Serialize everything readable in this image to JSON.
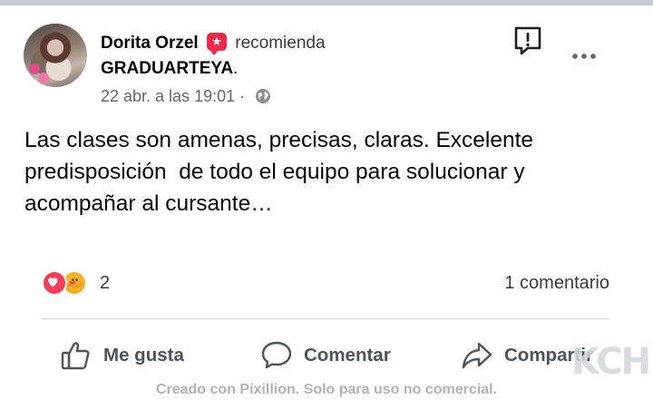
{
  "post": {
    "author": "Dorita Orzel",
    "badge_icon": "star-speech-bubble-icon",
    "badge_glyph": "★",
    "action_verb": "recomienda",
    "page_name": "GRADUARTEYA",
    "page_suffix": ".",
    "timestamp": "22 abr. a las 19:01",
    "separator": "·",
    "privacy_icon": "globe-icon",
    "text": "Las clases son amenas, precisas, claras. Excelente\npredisposición  de todo el equipo para solucionar y\nacompañar al cursante…"
  },
  "stats": {
    "reaction_icons": [
      "love-reaction-icon",
      "care-reaction-icon"
    ],
    "reaction_count": "2",
    "comment_count": "1 comentario"
  },
  "actions": {
    "like": "Me gusta",
    "comment": "Comentar",
    "share": "Compartir"
  },
  "watermark": {
    "logo": "KCH",
    "text": "Creado con Pixillion. Solo para uso no comercial."
  },
  "colors": {
    "recommend_badge": "#f02849",
    "love": "#f33e58",
    "care": "#f7b125",
    "secondary_text": "#65676b",
    "action_text": "#505357"
  }
}
